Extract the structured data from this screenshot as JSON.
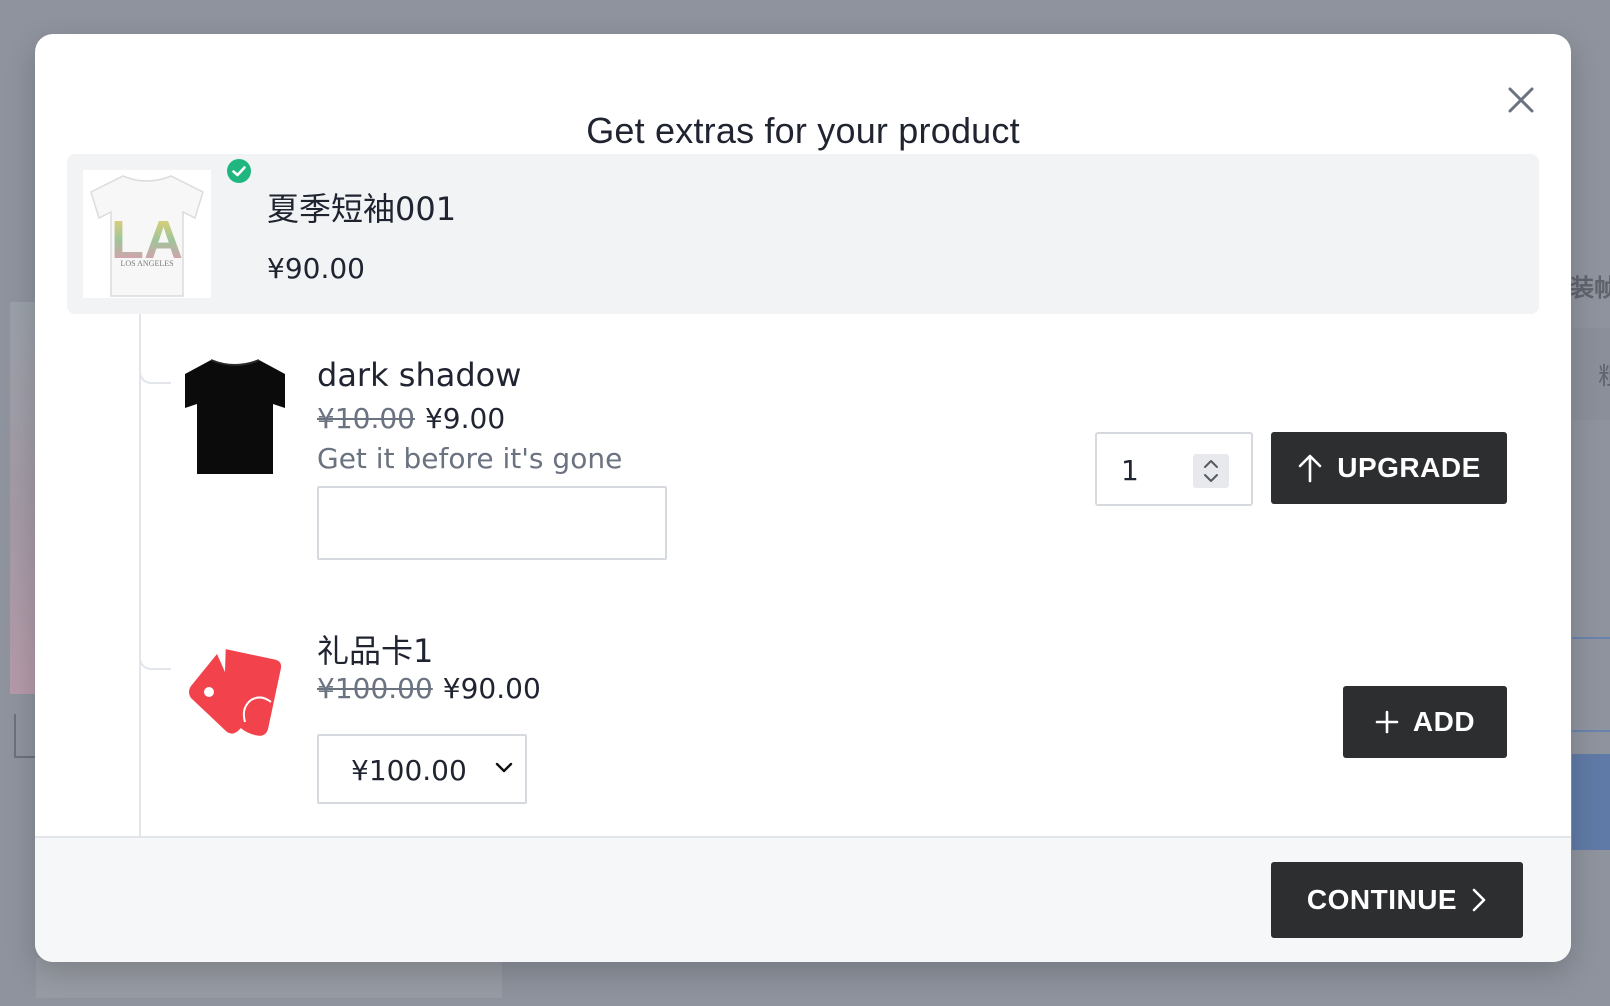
{
  "background": {
    "side_text_1": "装帧",
    "side_text_2": "粗"
  },
  "modal": {
    "title": "Get extras for your product",
    "close_icon": "close-icon",
    "main_product": {
      "name": "夏季短袖001",
      "price": "¥90.00",
      "image_caption": "LOS ANGELES",
      "image_letters": "LA",
      "selected": true,
      "check_color": "#1fb77f"
    },
    "upsells": [
      {
        "name": "dark shadow",
        "original_price": "¥10.00",
        "price": "¥9.00",
        "description": "Get it before it's gone",
        "text_input_value": "",
        "quantity": "1",
        "button_label": "UPGRADE",
        "button_icon": "arrow-up-icon"
      },
      {
        "name": "礼品卡1",
        "original_price": "¥100.00",
        "price": "¥90.00",
        "denomination_selected": "¥100.00",
        "button_label": "ADD",
        "button_icon": "plus-icon",
        "tag_color": "#f2424b"
      }
    ],
    "footer": {
      "continue_label": "CONTINUE",
      "continue_icon": "chevron-right-icon"
    }
  },
  "colors": {
    "button_dark": "#2d2e30",
    "card_bg": "#f2f3f5",
    "overlay": "#8e939d"
  }
}
